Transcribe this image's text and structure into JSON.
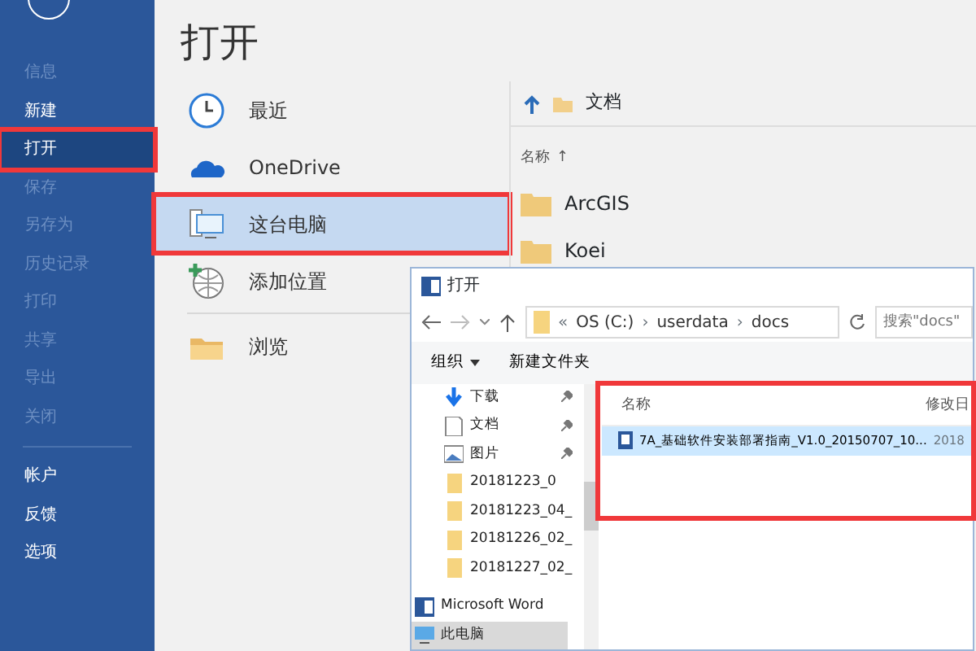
{
  "sidebar": {
    "items": [
      {
        "label": "信息",
        "selected": false,
        "disabled": true
      },
      {
        "label": "新建",
        "selected": false,
        "disabled": false
      },
      {
        "label": "打开",
        "selected": true,
        "disabled": false
      },
      {
        "label": "保存",
        "selected": false,
        "disabled": true
      },
      {
        "label": "另存为",
        "selected": false,
        "disabled": true
      },
      {
        "label": "历史记录",
        "selected": false,
        "disabled": true
      },
      {
        "label": "打印",
        "selected": false,
        "disabled": true
      },
      {
        "label": "共享",
        "selected": false,
        "disabled": true
      },
      {
        "label": "导出",
        "selected": false,
        "disabled": true
      },
      {
        "label": "关闭",
        "selected": false,
        "disabled": true
      }
    ],
    "bottom_items": [
      {
        "label": "帐户",
        "selected": false,
        "disabled": false
      },
      {
        "label": "反馈",
        "selected": false,
        "disabled": false
      },
      {
        "label": "选项",
        "selected": false,
        "disabled": false
      }
    ]
  },
  "page_title": "打开",
  "places": [
    {
      "label": "最近",
      "kind": "recent",
      "selected": false
    },
    {
      "label": "OneDrive",
      "kind": "cloud",
      "selected": false
    },
    {
      "label": "这台电脑",
      "kind": "computer",
      "selected": true
    },
    {
      "label": "添加位置",
      "kind": "add",
      "selected": false
    },
    {
      "label": "浏览",
      "kind": "browse",
      "selected": false
    }
  ],
  "browser": {
    "breadcrumb": "文档",
    "sort_header": "名称",
    "sort_arrow": "↑",
    "folders": [
      "ArcGIS",
      "Koei"
    ]
  },
  "dialog": {
    "title": "打开",
    "path_prefix": "«",
    "path_separator": "›",
    "path": [
      "OS (C:)",
      "userdata",
      "docs"
    ],
    "search_placeholder": "搜索\"docs\"",
    "toolbar": [
      {
        "label": "组织",
        "dropdown": true
      },
      {
        "label": "新建文件夹",
        "dropdown": false
      }
    ],
    "nav_items": [
      {
        "label": "下载",
        "kind": "download",
        "pinned": true,
        "selected": false
      },
      {
        "label": "文档",
        "kind": "document",
        "pinned": true,
        "selected": false
      },
      {
        "label": "图片",
        "kind": "picture",
        "pinned": true,
        "selected": false
      },
      {
        "label": "20181223_0",
        "kind": "folder",
        "pinned": false,
        "selected": false
      },
      {
        "label": "20181223_04_",
        "kind": "folder",
        "pinned": false,
        "selected": false
      },
      {
        "label": "20181226_02_",
        "kind": "folder",
        "pinned": false,
        "selected": false
      },
      {
        "label": "20181227_02_",
        "kind": "folder",
        "pinned": false,
        "selected": false
      },
      {
        "label": "Microsoft Word",
        "kind": "word",
        "pinned": false,
        "selected": false
      },
      {
        "label": "此电脑",
        "kind": "computer",
        "pinned": false,
        "selected": true
      }
    ],
    "columns": [
      "名称",
      "修改日"
    ],
    "files": [
      {
        "name": "7A_基础软件安装部署指南_V1.0_20150707_10...",
        "column_2": "2018",
        "selected": true
      }
    ]
  }
}
